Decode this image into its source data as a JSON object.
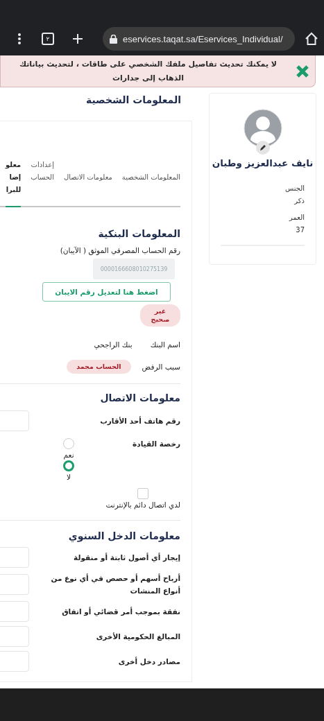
{
  "browser": {
    "tab_count": "٢",
    "url": "eservices.taqat.sa/Eservices_Individual/"
  },
  "alert": {
    "text": "لا يمكنك تحديث تفاصيل ملفك الشخصي على طاقات ، لتحديث بياناتك الذهاب إلى جدارات"
  },
  "page_title": "المعلومات الشخصية",
  "profile": {
    "name": "نايف عبدالعزيز وطبان",
    "fields": [
      {
        "label": "الجنس",
        "value": "ذكر"
      },
      {
        "label": "العمر",
        "value": "37"
      }
    ]
  },
  "tabs": [
    {
      "lines": [
        "المعلومات الشخصية"
      ],
      "selected": false
    },
    {
      "lines": [
        "معلومات الاتصال"
      ],
      "selected": false
    },
    {
      "lines": [
        "إعدادات",
        "الحساب"
      ],
      "selected": false
    },
    {
      "lines": [
        "معلو",
        "إضا",
        "للبرا"
      ],
      "selected": true
    }
  ],
  "bank": {
    "title": "المعلومات البنكية",
    "iban_label": "رقم الحساب المصرفي الموثق ( الآيبان)",
    "iban_value": "0000166608010275139",
    "edit_button": "اضغط هنا لتعديل رقم الايبان",
    "status": "غير صحيح",
    "bank_name_label": "اسم البنك",
    "bank_name": "بنك الراجحي",
    "reason_label": "سبب الرفض",
    "reason": "الحساب مجمد"
  },
  "contact": {
    "title": "معلومات الاتصال",
    "relative_phone_label": "رقم هاتف أحد الأقارب",
    "license_label": "رخصة القيادة",
    "license_options": [
      {
        "label": "نعم",
        "selected": false
      },
      {
        "label": "لا",
        "selected": true
      }
    ],
    "internet": {
      "label": "لدي اتصال دائم بالإنترنت",
      "checked": false
    }
  },
  "income": {
    "title": "معلومات الدخل السنوي",
    "fields": [
      {
        "label": "إيجار أي أصول ثابتة أو منقولة"
      },
      {
        "label": "أرباح أسهم أو حصص في أي نوع من أنواع المنشات"
      },
      {
        "label": "نفقة بموجب أمر قضائي أو اتفاق"
      },
      {
        "label": "المبالغ الحكومية الأخرى"
      },
      {
        "label": "مصادر دخل أخرى"
      }
    ]
  }
}
